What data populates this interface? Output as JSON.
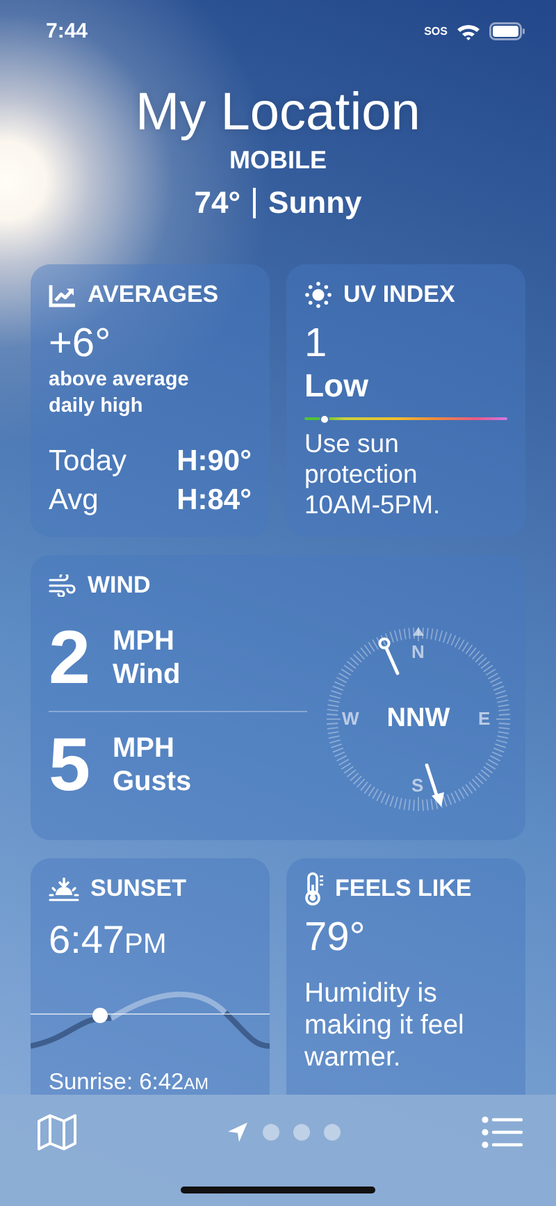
{
  "status_bar": {
    "time": "7:44",
    "carrier": "SOS"
  },
  "header": {
    "location": "My Location",
    "city": "MOBILE",
    "temperature": "74°",
    "condition": "Sunny"
  },
  "averages": {
    "title": "AVERAGES",
    "difference": "+6°",
    "description": "above average daily high",
    "rows": [
      {
        "label": "Today",
        "value": "H:90°"
      },
      {
        "label": "Avg",
        "value": "H:84°"
      }
    ]
  },
  "uv_index": {
    "title": "UV INDEX",
    "value": "1",
    "category": "Low",
    "level": 0.1,
    "advice": "Use sun protection 10AM-5PM."
  },
  "wind": {
    "title": "WIND",
    "rows": [
      {
        "speed": "2",
        "unit": "MPH",
        "label": "Wind"
      },
      {
        "speed": "5",
        "unit": "MPH",
        "label": "Gusts"
      }
    ],
    "compass": {
      "direction": "NNW",
      "north": "N",
      "east": "E",
      "south": "S",
      "west": "W"
    }
  },
  "sunset": {
    "title": "SUNSET",
    "time": "6:47",
    "suffix": "PM",
    "sunrise_label": "Sunrise: 6:42",
    "sunrise_suffix": "AM"
  },
  "feels_like": {
    "title": "FEELS LIKE",
    "value": "79°",
    "description": "Humidity is making it feel warmer."
  },
  "toolbar": {
    "pages": [
      {
        "kind": "location",
        "selected": true
      },
      {
        "kind": "dot",
        "selected": false
      },
      {
        "kind": "dot",
        "selected": false
      },
      {
        "kind": "dot",
        "selected": false
      }
    ]
  }
}
